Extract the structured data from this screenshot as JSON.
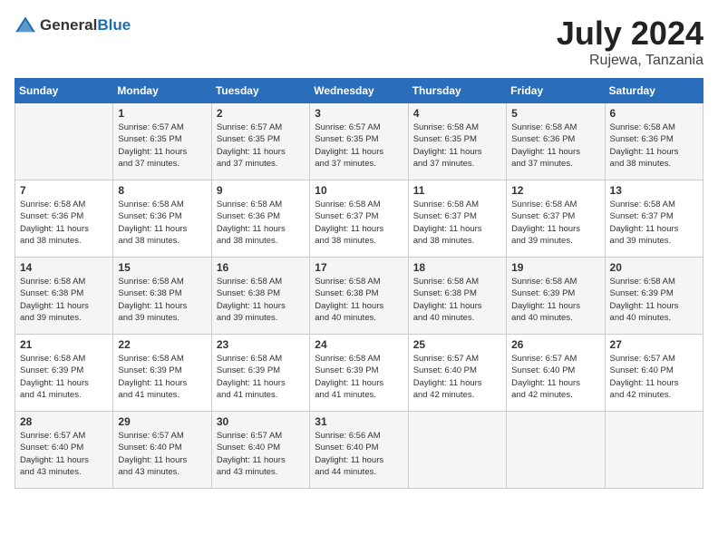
{
  "header": {
    "logo_general": "General",
    "logo_blue": "Blue",
    "title": "July 2024",
    "location": "Rujewa, Tanzania"
  },
  "days_of_week": [
    "Sunday",
    "Monday",
    "Tuesday",
    "Wednesday",
    "Thursday",
    "Friday",
    "Saturday"
  ],
  "weeks": [
    [
      {
        "day": "",
        "info": ""
      },
      {
        "day": "1",
        "info": "Sunrise: 6:57 AM\nSunset: 6:35 PM\nDaylight: 11 hours\nand 37 minutes."
      },
      {
        "day": "2",
        "info": "Sunrise: 6:57 AM\nSunset: 6:35 PM\nDaylight: 11 hours\nand 37 minutes."
      },
      {
        "day": "3",
        "info": "Sunrise: 6:57 AM\nSunset: 6:35 PM\nDaylight: 11 hours\nand 37 minutes."
      },
      {
        "day": "4",
        "info": "Sunrise: 6:58 AM\nSunset: 6:35 PM\nDaylight: 11 hours\nand 37 minutes."
      },
      {
        "day": "5",
        "info": "Sunrise: 6:58 AM\nSunset: 6:36 PM\nDaylight: 11 hours\nand 37 minutes."
      },
      {
        "day": "6",
        "info": "Sunrise: 6:58 AM\nSunset: 6:36 PM\nDaylight: 11 hours\nand 38 minutes."
      }
    ],
    [
      {
        "day": "7",
        "info": "Sunrise: 6:58 AM\nSunset: 6:36 PM\nDaylight: 11 hours\nand 38 minutes."
      },
      {
        "day": "8",
        "info": "Sunrise: 6:58 AM\nSunset: 6:36 PM\nDaylight: 11 hours\nand 38 minutes."
      },
      {
        "day": "9",
        "info": "Sunrise: 6:58 AM\nSunset: 6:36 PM\nDaylight: 11 hours\nand 38 minutes."
      },
      {
        "day": "10",
        "info": "Sunrise: 6:58 AM\nSunset: 6:37 PM\nDaylight: 11 hours\nand 38 minutes."
      },
      {
        "day": "11",
        "info": "Sunrise: 6:58 AM\nSunset: 6:37 PM\nDaylight: 11 hours\nand 38 minutes."
      },
      {
        "day": "12",
        "info": "Sunrise: 6:58 AM\nSunset: 6:37 PM\nDaylight: 11 hours\nand 39 minutes."
      },
      {
        "day": "13",
        "info": "Sunrise: 6:58 AM\nSunset: 6:37 PM\nDaylight: 11 hours\nand 39 minutes."
      }
    ],
    [
      {
        "day": "14",
        "info": "Sunrise: 6:58 AM\nSunset: 6:38 PM\nDaylight: 11 hours\nand 39 minutes."
      },
      {
        "day": "15",
        "info": "Sunrise: 6:58 AM\nSunset: 6:38 PM\nDaylight: 11 hours\nand 39 minutes."
      },
      {
        "day": "16",
        "info": "Sunrise: 6:58 AM\nSunset: 6:38 PM\nDaylight: 11 hours\nand 39 minutes."
      },
      {
        "day": "17",
        "info": "Sunrise: 6:58 AM\nSunset: 6:38 PM\nDaylight: 11 hours\nand 40 minutes."
      },
      {
        "day": "18",
        "info": "Sunrise: 6:58 AM\nSunset: 6:38 PM\nDaylight: 11 hours\nand 40 minutes."
      },
      {
        "day": "19",
        "info": "Sunrise: 6:58 AM\nSunset: 6:39 PM\nDaylight: 11 hours\nand 40 minutes."
      },
      {
        "day": "20",
        "info": "Sunrise: 6:58 AM\nSunset: 6:39 PM\nDaylight: 11 hours\nand 40 minutes."
      }
    ],
    [
      {
        "day": "21",
        "info": "Sunrise: 6:58 AM\nSunset: 6:39 PM\nDaylight: 11 hours\nand 41 minutes."
      },
      {
        "day": "22",
        "info": "Sunrise: 6:58 AM\nSunset: 6:39 PM\nDaylight: 11 hours\nand 41 minutes."
      },
      {
        "day": "23",
        "info": "Sunrise: 6:58 AM\nSunset: 6:39 PM\nDaylight: 11 hours\nand 41 minutes."
      },
      {
        "day": "24",
        "info": "Sunrise: 6:58 AM\nSunset: 6:39 PM\nDaylight: 11 hours\nand 41 minutes."
      },
      {
        "day": "25",
        "info": "Sunrise: 6:57 AM\nSunset: 6:40 PM\nDaylight: 11 hours\nand 42 minutes."
      },
      {
        "day": "26",
        "info": "Sunrise: 6:57 AM\nSunset: 6:40 PM\nDaylight: 11 hours\nand 42 minutes."
      },
      {
        "day": "27",
        "info": "Sunrise: 6:57 AM\nSunset: 6:40 PM\nDaylight: 11 hours\nand 42 minutes."
      }
    ],
    [
      {
        "day": "28",
        "info": "Sunrise: 6:57 AM\nSunset: 6:40 PM\nDaylight: 11 hours\nand 43 minutes."
      },
      {
        "day": "29",
        "info": "Sunrise: 6:57 AM\nSunset: 6:40 PM\nDaylight: 11 hours\nand 43 minutes."
      },
      {
        "day": "30",
        "info": "Sunrise: 6:57 AM\nSunset: 6:40 PM\nDaylight: 11 hours\nand 43 minutes."
      },
      {
        "day": "31",
        "info": "Sunrise: 6:56 AM\nSunset: 6:40 PM\nDaylight: 11 hours\nand 44 minutes."
      },
      {
        "day": "",
        "info": ""
      },
      {
        "day": "",
        "info": ""
      },
      {
        "day": "",
        "info": ""
      }
    ]
  ]
}
